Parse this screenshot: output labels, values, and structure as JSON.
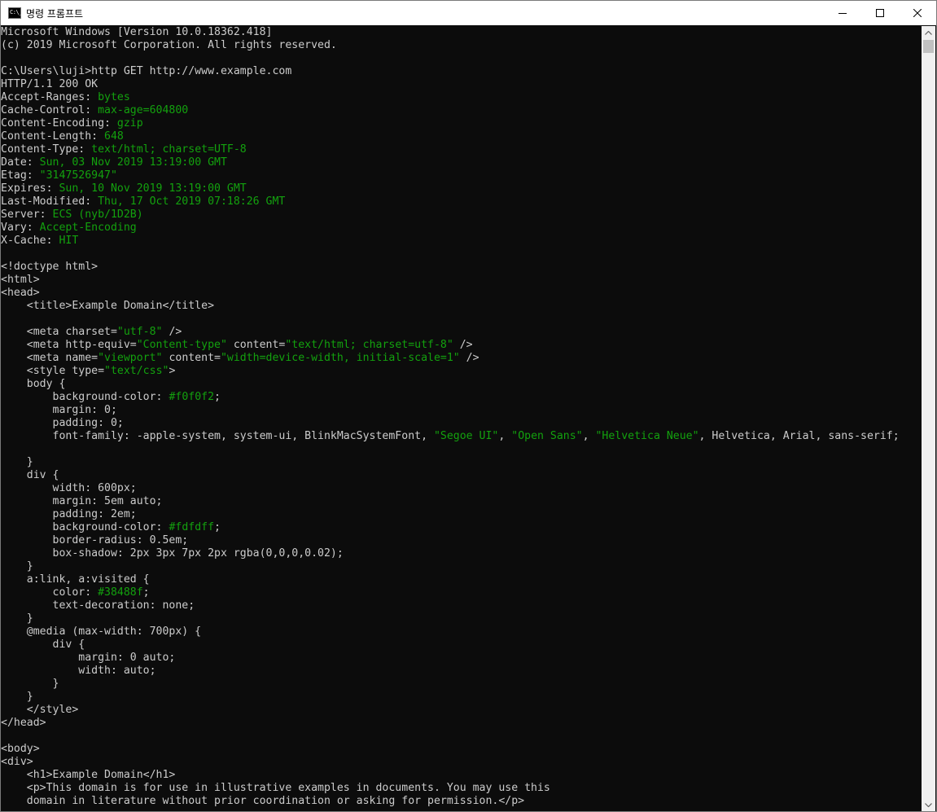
{
  "window": {
    "title": "명령 프롬프트",
    "icon": "cmd-icon",
    "icon_text": "C:\\_",
    "controls": [
      "minimize-icon",
      "maximize-icon",
      "close-icon"
    ]
  },
  "colors": {
    "background": "#0c0c0c",
    "text": "#cccccc",
    "value": "#13a10e"
  },
  "console": {
    "lines": [
      [
        {
          "t": "Microsoft Windows [Version 10.0.18362.418]"
        }
      ],
      [
        {
          "t": "(c) 2019 Microsoft Corporation. All rights reserved."
        }
      ],
      [
        {
          "t": ""
        }
      ],
      [
        {
          "t": "C:\\Users\\luji>http GET http://www.example.com"
        }
      ],
      [
        {
          "t": "HTTP/1.1 200 OK"
        }
      ],
      [
        {
          "t": "Accept-Ranges: "
        },
        {
          "t": "bytes",
          "c": "v"
        }
      ],
      [
        {
          "t": "Cache-Control: "
        },
        {
          "t": "max-age=604800",
          "c": "v"
        }
      ],
      [
        {
          "t": "Content-Encoding: "
        },
        {
          "t": "gzip",
          "c": "v"
        }
      ],
      [
        {
          "t": "Content-Length: "
        },
        {
          "t": "648",
          "c": "v"
        }
      ],
      [
        {
          "t": "Content-Type: "
        },
        {
          "t": "text/html; charset=UTF-8",
          "c": "v"
        }
      ],
      [
        {
          "t": "Date: "
        },
        {
          "t": "Sun, 03 Nov 2019 13:19:00 GMT",
          "c": "v"
        }
      ],
      [
        {
          "t": "Etag: "
        },
        {
          "t": "\"3147526947\"",
          "c": "v"
        }
      ],
      [
        {
          "t": "Expires: "
        },
        {
          "t": "Sun, 10 Nov 2019 13:19:00 GMT",
          "c": "v"
        }
      ],
      [
        {
          "t": "Last-Modified: "
        },
        {
          "t": "Thu, 17 Oct 2019 07:18:26 GMT",
          "c": "v"
        }
      ],
      [
        {
          "t": "Server: "
        },
        {
          "t": "ECS (nyb/1D2B)",
          "c": "v"
        }
      ],
      [
        {
          "t": "Vary: "
        },
        {
          "t": "Accept-Encoding",
          "c": "v"
        }
      ],
      [
        {
          "t": "X-Cache: "
        },
        {
          "t": "HIT",
          "c": "v"
        }
      ],
      [
        {
          "t": ""
        }
      ],
      [
        {
          "t": "<!doctype html>"
        }
      ],
      [
        {
          "t": "<html>"
        }
      ],
      [
        {
          "t": "<head>"
        }
      ],
      [
        {
          "t": "    <title>Example Domain</title>"
        }
      ],
      [
        {
          "t": ""
        }
      ],
      [
        {
          "t": "    <meta charset="
        },
        {
          "t": "\"utf-8\"",
          "c": "v"
        },
        {
          "t": " />"
        }
      ],
      [
        {
          "t": "    <meta http-equiv="
        },
        {
          "t": "\"Content-type\"",
          "c": "v"
        },
        {
          "t": " content="
        },
        {
          "t": "\"text/html; charset=utf-8\"",
          "c": "v"
        },
        {
          "t": " />"
        }
      ],
      [
        {
          "t": "    <meta name="
        },
        {
          "t": "\"viewport\"",
          "c": "v"
        },
        {
          "t": " content="
        },
        {
          "t": "\"width=device-width, initial-scale=1\"",
          "c": "v"
        },
        {
          "t": " />"
        }
      ],
      [
        {
          "t": "    <style type="
        },
        {
          "t": "\"text/css\"",
          "c": "v"
        },
        {
          "t": ">"
        }
      ],
      [
        {
          "t": "    body {"
        }
      ],
      [
        {
          "t": "        background-color: "
        },
        {
          "t": "#f0f0f2",
          "c": "v"
        },
        {
          "t": ";"
        }
      ],
      [
        {
          "t": "        margin: 0;"
        }
      ],
      [
        {
          "t": "        padding: 0;"
        }
      ],
      [
        {
          "t": "        font-family: -apple-system, system-ui, BlinkMacSystemFont, "
        },
        {
          "t": "\"Segoe UI\"",
          "c": "v"
        },
        {
          "t": ", "
        },
        {
          "t": "\"Open Sans\"",
          "c": "v"
        },
        {
          "t": ", "
        },
        {
          "t": "\"Helvetica Neue\"",
          "c": "v"
        },
        {
          "t": ", Helvetica, Arial, sans-serif;"
        }
      ],
      [
        {
          "t": ""
        }
      ],
      [
        {
          "t": "    }"
        }
      ],
      [
        {
          "t": "    div {"
        }
      ],
      [
        {
          "t": "        width: 600px;"
        }
      ],
      [
        {
          "t": "        margin: 5em auto;"
        }
      ],
      [
        {
          "t": "        padding: 2em;"
        }
      ],
      [
        {
          "t": "        background-color: "
        },
        {
          "t": "#fdfdff",
          "c": "v"
        },
        {
          "t": ";"
        }
      ],
      [
        {
          "t": "        border-radius: 0.5em;"
        }
      ],
      [
        {
          "t": "        box-shadow: 2px 3px 7px 2px rgba(0,0,0,0.02);"
        }
      ],
      [
        {
          "t": "    }"
        }
      ],
      [
        {
          "t": "    a:link, a:visited {"
        }
      ],
      [
        {
          "t": "        color: "
        },
        {
          "t": "#38488f",
          "c": "v"
        },
        {
          "t": ";"
        }
      ],
      [
        {
          "t": "        text-decoration: none;"
        }
      ],
      [
        {
          "t": "    }"
        }
      ],
      [
        {
          "t": "    @media (max-width: 700px) {"
        }
      ],
      [
        {
          "t": "        div {"
        }
      ],
      [
        {
          "t": "            margin: 0 auto;"
        }
      ],
      [
        {
          "t": "            width: auto;"
        }
      ],
      [
        {
          "t": "        }"
        }
      ],
      [
        {
          "t": "    }"
        }
      ],
      [
        {
          "t": "    </style>"
        }
      ],
      [
        {
          "t": "</head>"
        }
      ],
      [
        {
          "t": ""
        }
      ],
      [
        {
          "t": "<body>"
        }
      ],
      [
        {
          "t": "<div>"
        }
      ],
      [
        {
          "t": "    <h1>Example Domain</h1>"
        }
      ],
      [
        {
          "t": "    <p>This domain is for use in illustrative examples in documents. You may use this"
        }
      ],
      [
        {
          "t": "    domain in literature without prior coordination or asking for permission.</p>"
        }
      ]
    ]
  },
  "scrollbar": {
    "up_icon": "scroll-up-arrow-icon",
    "down_icon": "scroll-down-arrow-icon"
  }
}
